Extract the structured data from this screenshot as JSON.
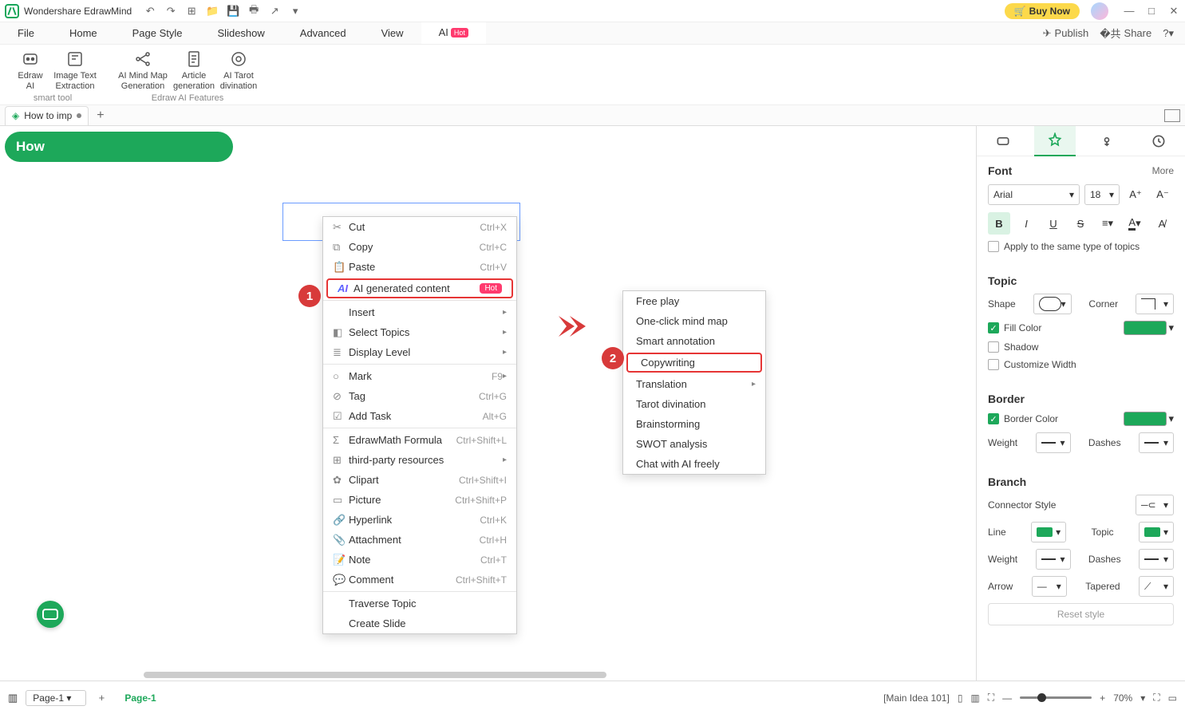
{
  "app_title": "Wondershare EdrawMind",
  "buy_label": "Buy Now",
  "menu": [
    "File",
    "Home",
    "Page Style",
    "Slideshow",
    "Advanced",
    "View",
    "AI"
  ],
  "menu_hot": "Hot",
  "mb_right": {
    "publish": "Publish",
    "share": "Share"
  },
  "ribbon": {
    "edraw_ai": "Edraw\nAI",
    "image_text": "Image Text\nExtraction",
    "ai_mind": "AI Mind Map\nGeneration",
    "article": "Article\ngeneration",
    "tarot": "AI Tarot\ndivination",
    "group1": "smart tool",
    "group2": "Edraw AI Features"
  },
  "doc_tab": "How to imp",
  "topic_text": "How",
  "ctx1": [
    {
      "ic": "✂",
      "lbl": "Cut",
      "key": "Ctrl+X"
    },
    {
      "ic": "⧉",
      "lbl": "Copy",
      "key": "Ctrl+C"
    },
    {
      "ic": "📋",
      "lbl": "Paste",
      "key": "Ctrl+V"
    },
    {
      "ic": "AI",
      "lbl": "AI generated content",
      "hot": true,
      "hl": true
    },
    {
      "sep": true
    },
    {
      "lbl": "Insert",
      "sub": true
    },
    {
      "ic": "◧",
      "lbl": "Select Topics",
      "sub": true
    },
    {
      "ic": "≣",
      "lbl": "Display Level",
      "sub": true
    },
    {
      "sep": true
    },
    {
      "ic": "○",
      "lbl": "Mark",
      "key": "F9",
      "sub": true
    },
    {
      "ic": "⊘",
      "lbl": "Tag",
      "key": "Ctrl+G"
    },
    {
      "ic": "☑",
      "lbl": "Add Task"
    },
    {
      "sep": true,
      "key": "Alt+G"
    },
    {
      "ic": "Σ",
      "lbl": "EdrawMath Formula",
      "key": "Ctrl+Shift+L"
    },
    {
      "ic": "⊞",
      "lbl": "third-party resources",
      "sub": true
    },
    {
      "ic": "✿",
      "lbl": "Clipart",
      "key": "Ctrl+Shift+I"
    },
    {
      "ic": "▭",
      "lbl": "Picture",
      "key": "Ctrl+Shift+P"
    },
    {
      "ic": "🔗",
      "lbl": "Hyperlink",
      "key": "Ctrl+K"
    },
    {
      "ic": "📎",
      "lbl": "Attachment",
      "key": "Ctrl+H"
    },
    {
      "ic": "📝",
      "lbl": "Note",
      "key": "Ctrl+T"
    },
    {
      "ic": "💬",
      "lbl": "Comment",
      "key": "Ctrl+Shift+T"
    },
    {
      "sep": true
    },
    {
      "lbl": "Traverse Topic"
    },
    {
      "lbl": "Create Slide"
    }
  ],
  "alt_g": "Alt+G",
  "ctx2": [
    {
      "lbl": "Free play"
    },
    {
      "lbl": "One-click mind map"
    },
    {
      "lbl": "Smart annotation"
    },
    {
      "lbl": "Copywriting",
      "hl": true
    },
    {
      "lbl": "Translation",
      "sub": true
    },
    {
      "lbl": "Tarot divination"
    },
    {
      "lbl": "Brainstorming"
    },
    {
      "lbl": "SWOT analysis"
    },
    {
      "lbl": "Chat with AI freely"
    }
  ],
  "annot": {
    "n1": "1",
    "n2": "2"
  },
  "rp": {
    "font_h": "Font",
    "more": "More",
    "font_name": "Arial",
    "font_size": "18",
    "apply_same": "Apply to the same type of topics",
    "topic_h": "Topic",
    "shape": "Shape",
    "corner": "Corner",
    "fill_color": "Fill Color",
    "shadow": "Shadow",
    "custom_w": "Customize Width",
    "border_h": "Border",
    "border_color": "Border Color",
    "weight": "Weight",
    "dashes": "Dashes",
    "branch_h": "Branch",
    "conn_style": "Connector Style",
    "line": "Line",
    "topic": "Topic",
    "arrow": "Arrow",
    "tapered": "Tapered",
    "reset": "Reset style"
  },
  "status": {
    "page_drop": "Page-1",
    "page_tab": "Page-1",
    "coord": "[Main Idea 101]",
    "zoom": "70%"
  }
}
